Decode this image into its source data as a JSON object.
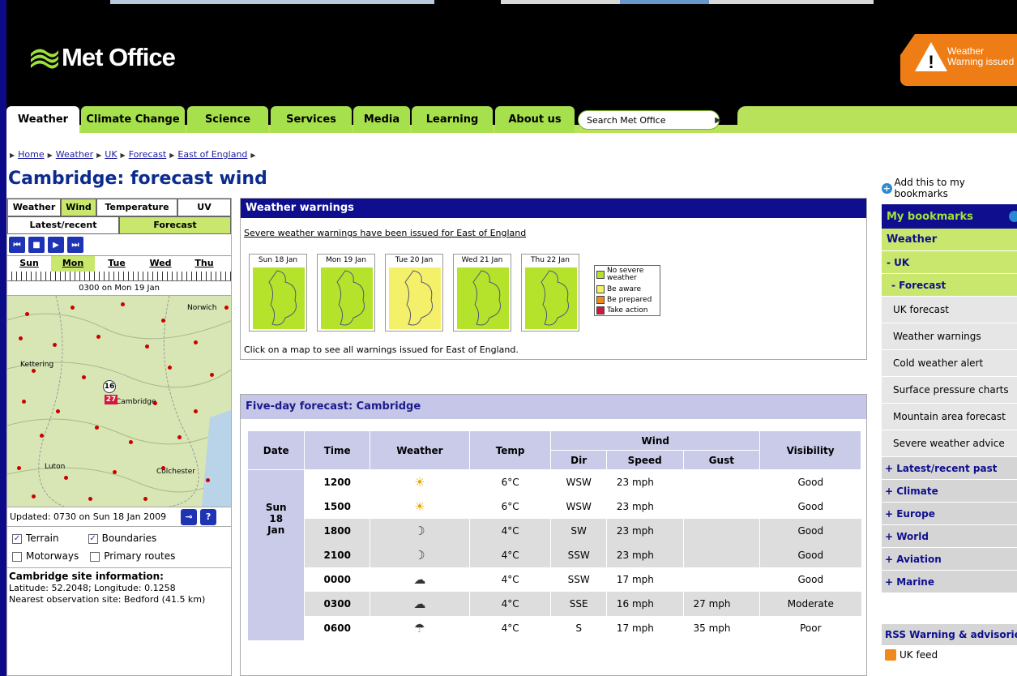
{
  "header": {
    "logo_text": "Met Office",
    "warning_badge": {
      "line1": "Weather",
      "line2": "Warning issued",
      "icon": "warning-triangle-icon"
    }
  },
  "nav": {
    "tabs": [
      {
        "label": "Weather",
        "active": true
      },
      {
        "label": "Climate Change"
      },
      {
        "label": "Science"
      },
      {
        "label": "Services"
      },
      {
        "label": "Media"
      },
      {
        "label": "Learning"
      },
      {
        "label": "About us"
      }
    ],
    "search_placeholder": "Search Met Office"
  },
  "breadcrumb": [
    "Home",
    "Weather",
    "UK",
    "Forecast",
    "East of England"
  ],
  "page_title": "Cambridge: forecast wind",
  "left_panel": {
    "tabs": [
      "Weather",
      "Wind",
      "Temperature",
      "UV"
    ],
    "subtabs": [
      "Latest/recent",
      "Forecast"
    ],
    "days": [
      "Sun",
      "Mon",
      "Tue",
      "Wed",
      "Thu"
    ],
    "time_label": "0300 on Mon 19 Jan",
    "map_labels": {
      "norwich": "Norwich",
      "kettering": "Kettering",
      "cambridge": "Cambridge",
      "luton": "Luton",
      "colchester": "Colchester"
    },
    "cambridge_speed": "16",
    "cambridge_gust": "27",
    "updated": "Updated: 0730 on Sun 18 Jan 2009",
    "options": {
      "terrain": "Terrain",
      "boundaries": "Boundaries",
      "motorways": "Motorways",
      "primary_routes": "Primary routes"
    },
    "site_title": "Cambridge site information:",
    "site_latlon": "Latitude: 52.2048; Longitude: 0.1258",
    "site_obs": "Nearest observation site: Bedford (41.5 km)"
  },
  "warnings": {
    "title": "Weather warnings",
    "link": "Severe weather warnings have been issued for East of England",
    "maps": [
      {
        "date": "Sun 18 Jan",
        "color": "#b5e32c"
      },
      {
        "date": "Mon 19 Jan",
        "color": "#b5e32c"
      },
      {
        "date": "Tue 20 Jan",
        "color": "#f5f06a"
      },
      {
        "date": "Wed 21 Jan",
        "color": "#b5e32c"
      },
      {
        "date": "Thu 22 Jan",
        "color": "#b5e32c"
      }
    ],
    "legend": [
      {
        "label": "No severe weather",
        "color": "#b5e32c"
      },
      {
        "label": "Be aware",
        "color": "#f5f06a"
      },
      {
        "label": "Be prepared",
        "color": "#f08a1c"
      },
      {
        "label": "Take action",
        "color": "#d3163c"
      }
    ],
    "note": "Click on a map to see all warnings issued for East of England."
  },
  "forecast": {
    "title": "Five-day forecast: Cambridge",
    "headers": {
      "date": "Date",
      "time": "Time",
      "weather": "Weather",
      "temp": "Temp",
      "wind": "Wind",
      "dir": "Dir",
      "speed": "Speed",
      "gust": "Gust",
      "visibility": "Visibility"
    },
    "day1": {
      "l1": "Sun",
      "l2": "18",
      "l3": "Jan"
    },
    "rows": [
      {
        "time": "1200",
        "icon": "☀",
        "temp": "6°C",
        "dir": "WSW",
        "speed": "23 mph",
        "gust": "",
        "vis": "Good"
      },
      {
        "time": "1500",
        "icon": "☀",
        "temp": "6°C",
        "dir": "WSW",
        "speed": "23 mph",
        "gust": "",
        "vis": "Good"
      },
      {
        "time": "1800",
        "icon": "☽",
        "temp": "4°C",
        "dir": "SW",
        "speed": "23 mph",
        "gust": "",
        "vis": "Good"
      },
      {
        "time": "2100",
        "icon": "☽",
        "temp": "4°C",
        "dir": "SSW",
        "speed": "23 mph",
        "gust": "",
        "vis": "Good"
      },
      {
        "time": "0000",
        "icon": "☁",
        "temp": "4°C",
        "dir": "SSW",
        "speed": "17 mph",
        "gust": "",
        "vis": "Good"
      },
      {
        "time": "0300",
        "icon": "☁",
        "temp": "4°C",
        "dir": "SSE",
        "speed": "16 mph",
        "gust": "27 mph",
        "vis": "Moderate"
      },
      {
        "time": "0600",
        "icon": "☂",
        "temp": "4°C",
        "dir": "S",
        "speed": "17 mph",
        "gust": "35 mph",
        "vis": "Poor"
      }
    ]
  },
  "right_panel": {
    "bookmark_add": "Add this to my bookmarks",
    "my_bookmarks": "My bookmarks",
    "weather": "Weather",
    "uk": "- UK",
    "forecast": "- Forecast",
    "links": [
      "UK forecast",
      "Weather warnings",
      "Cold weather alert",
      "Surface pressure charts",
      "Mountain area forecast",
      "Severe weather advice"
    ],
    "groups": [
      "+ Latest/recent past",
      "+ Climate",
      "+ Europe",
      "+ World",
      "+ Aviation",
      "+ Marine"
    ],
    "rss_title": "RSS Warning & advisories",
    "rss_feed": "UK feed"
  }
}
